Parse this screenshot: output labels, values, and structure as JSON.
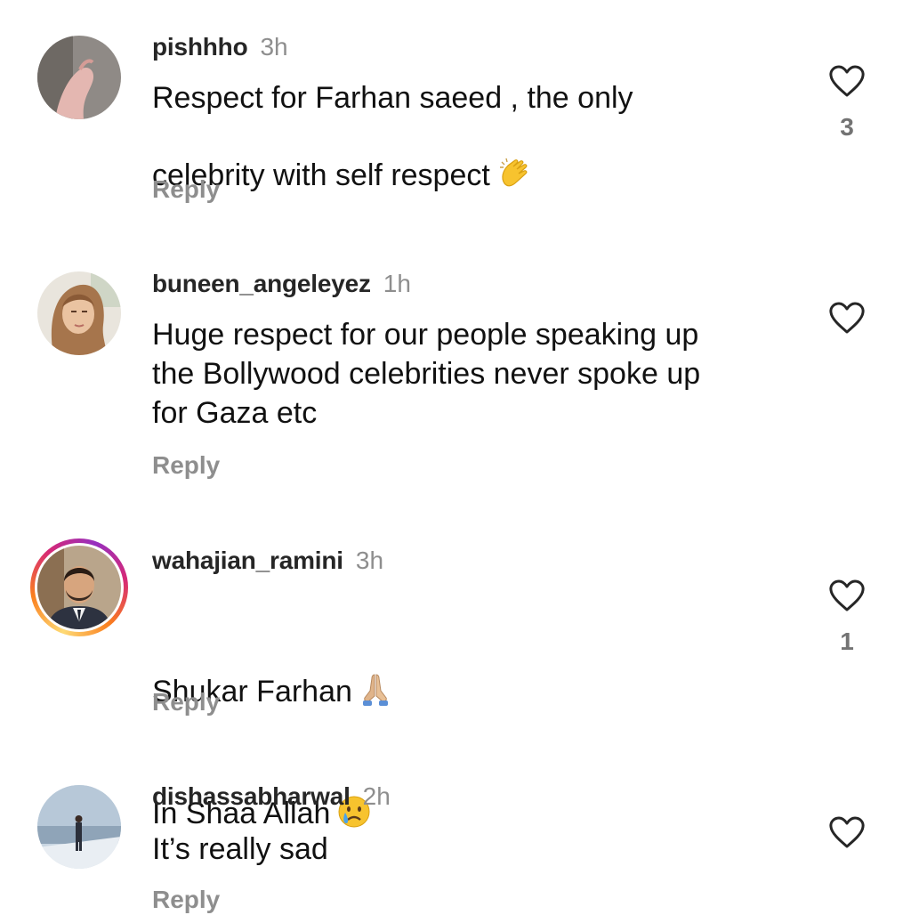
{
  "comments": [
    {
      "username": "pishhho",
      "time": "3h",
      "text": "Respect for Farhan saeed , the only\ncelebrity with self respect",
      "emoji": "clapping-hands-emoji",
      "reply_label": "Reply",
      "likes": "3"
    },
    {
      "username": "buneen_angeleyez",
      "time": "1h",
      "text": "Huge respect for our people speaking up\nthe Bollywood celebrities never spoke up\nfor Gaza etc",
      "reply_label": "Reply",
      "likes": ""
    },
    {
      "username": "wahajian_ramini",
      "time": "3h",
      "line1": "Shukar Farhan",
      "line1_emoji": "folded-hands-emoji",
      "line2": "In Shaa Allah",
      "line2_emoji": "crying-face-emoji",
      "reply_label": "Reply",
      "likes": "1"
    },
    {
      "username": "dishassabharwal",
      "time": "2h",
      "text": "It’s really sad",
      "reply_label": "Reply",
      "likes": ""
    }
  ],
  "icons": {
    "like": "heart-outline-icon"
  },
  "colors": {
    "username": "#262626",
    "secondary_text": "#8e8e8e",
    "story_ring_start": "#feda75",
    "story_ring_end": "#962fbf"
  }
}
